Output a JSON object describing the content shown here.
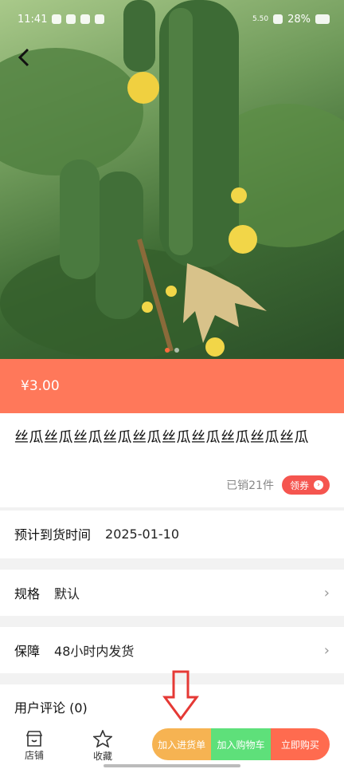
{
  "status_bar": {
    "time": "11:41",
    "network_speed": "5.50",
    "battery": "28%"
  },
  "gallery": {
    "active_index": 0,
    "count": 2
  },
  "product": {
    "price": "¥3.00",
    "title": "丝瓜丝瓜丝瓜丝瓜丝瓜丝瓜丝瓜丝瓜丝瓜丝瓜",
    "sold": "已销21件",
    "coupon_label": "领券"
  },
  "delivery": {
    "label": "预计到货时间",
    "value": "2025-01-10"
  },
  "spec": {
    "label": "规格",
    "value": "默认"
  },
  "guarantee": {
    "label": "保障",
    "value": "48小时内发货"
  },
  "reviews": {
    "label": "用户评论 (0)"
  },
  "tabbar": {
    "store_label": "店铺",
    "favorite_label": "收藏",
    "add_restock_label": "加入进货单",
    "add_cart_label": "加入购物车",
    "buy_now_label": "立即购买"
  },
  "colors": {
    "accent": "#ff785a",
    "coupon": "#f5554f",
    "restock": "#f6b352",
    "cart": "#5ee07a",
    "buy": "#ff6b4f",
    "annotation_arrow": "#e53935"
  },
  "icons": {
    "back": "chevron-left-icon",
    "store": "store-icon",
    "favorite": "star-icon",
    "chevron": "chevron-right-icon",
    "annotation": "arrow-down-icon"
  }
}
